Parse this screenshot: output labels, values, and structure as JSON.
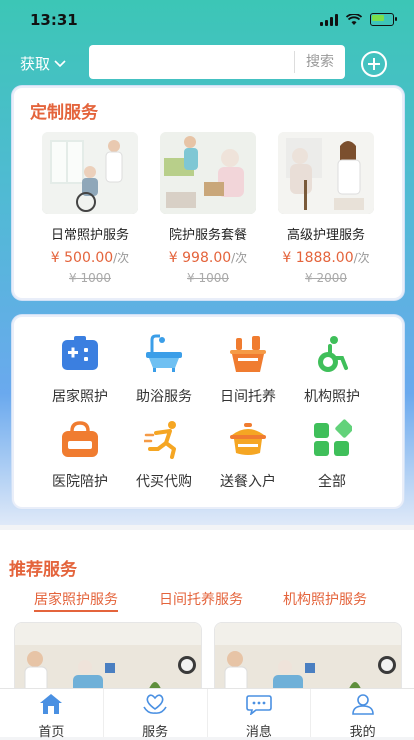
{
  "status": {
    "time": "13:31"
  },
  "header": {
    "location_label": "获取",
    "search_placeholder": "",
    "search_button": "搜索"
  },
  "custom": {
    "title": "定制服务",
    "services": [
      {
        "name": "日常照护服务",
        "price": "¥ 500.00",
        "unit": "/次",
        "old_price": "¥ 1000"
      },
      {
        "name": "院护服务套餐",
        "price": "¥ 998.00",
        "unit": "/次",
        "old_price": "¥ 1000"
      },
      {
        "name": "高级护理服务",
        "price": "¥ 1888.00",
        "unit": "/次",
        "old_price": "¥ 2000"
      }
    ]
  },
  "categories": [
    {
      "label": "居家照护",
      "icon": "medical-kit-icon"
    },
    {
      "label": "助浴服务",
      "icon": "bathtub-icon"
    },
    {
      "label": "日间托养",
      "icon": "basket-icon"
    },
    {
      "label": "机构照护",
      "icon": "wheelchair-icon"
    },
    {
      "label": "医院陪护",
      "icon": "hospital-bag-icon"
    },
    {
      "label": "代买代购",
      "icon": "running-person-icon"
    },
    {
      "label": "送餐入户",
      "icon": "food-pot-icon"
    },
    {
      "label": "全部",
      "icon": "grid-icon"
    }
  ],
  "recommend": {
    "title": "推荐服务",
    "tabs": [
      "居家照护服务",
      "日间托养服务",
      "机构照护服务"
    ],
    "active_tab": 0
  },
  "nav": [
    {
      "label": "首页",
      "icon": "home-icon",
      "active": true
    },
    {
      "label": "服务",
      "icon": "heart-hands-icon"
    },
    {
      "label": "消息",
      "icon": "chat-bubble-icon"
    },
    {
      "label": "我的",
      "icon": "user-icon"
    }
  ],
  "colors": {
    "accent": "#e4643c",
    "header_gradient_top": "#3cc6b6",
    "header_gradient_bottom": "#6aa9ee",
    "nav_active": "#4a90e2"
  }
}
